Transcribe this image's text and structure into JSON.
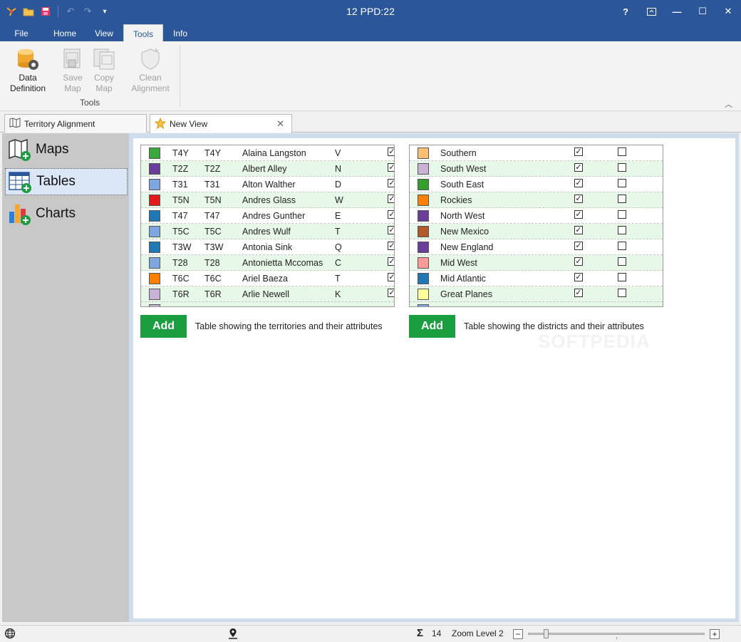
{
  "window": {
    "title": "12 PPD:22",
    "help": "?",
    "minimize": "—",
    "maximize": "☐",
    "close": "✕"
  },
  "ribbon_tabs": [
    "File",
    "Home",
    "View",
    "Tools",
    "Info"
  ],
  "ribbon": {
    "buttons": [
      {
        "label1": "Data",
        "label2": "Definition",
        "icon": "database-gear-icon",
        "enabled": true
      },
      {
        "label1": "Save",
        "label2": "Map",
        "icon": "save-map-icon",
        "enabled": false
      },
      {
        "label1": "Copy",
        "label2": "Map",
        "icon": "copy-map-icon",
        "enabled": false
      },
      {
        "label1": "Clean",
        "label2": "Alignment",
        "icon": "clean-alignment-icon",
        "enabled": false
      }
    ],
    "group_label": "Tools"
  },
  "doc_tabs": [
    {
      "label": "Territory Alignment",
      "icon": "map-icon"
    },
    {
      "label": "New View",
      "icon": "star-icon",
      "close": "✕"
    }
  ],
  "sidebar": {
    "items": [
      {
        "label": "Maps",
        "icon": "map-add-icon"
      },
      {
        "label": "Tables",
        "icon": "table-add-icon"
      },
      {
        "label": "Charts",
        "icon": "chart-add-icon"
      }
    ]
  },
  "territories": {
    "rows": [
      {
        "color": "#3aa83a",
        "code1": "T4Y",
        "code2": "T4Y",
        "name": "Alaina Langston",
        "letter": "V",
        "checked": true
      },
      {
        "color": "#6a3d9a",
        "code1": "T2Z",
        "code2": "T2Z",
        "name": "Albert Alley",
        "letter": "N",
        "checked": true
      },
      {
        "color": "#7ea6e0",
        "code1": "T31",
        "code2": "T31",
        "name": "Alton Walther",
        "letter": "D",
        "checked": true
      },
      {
        "color": "#e31a1c",
        "code1": "T5N",
        "code2": "T5N",
        "name": "Andres Glass",
        "letter": "W",
        "checked": true
      },
      {
        "color": "#1f78b4",
        "code1": "T47",
        "code2": "T47",
        "name": "Andres Gunther",
        "letter": "E",
        "checked": true
      },
      {
        "color": "#7ea6e0",
        "code1": "T5C",
        "code2": "T5C",
        "name": "Andres Wulf",
        "letter": "T",
        "checked": true
      },
      {
        "color": "#1f78b4",
        "code1": "T3W",
        "code2": "T3W",
        "name": "Antonia Sink",
        "letter": "Q",
        "checked": true
      },
      {
        "color": "#7ea6e0",
        "code1": "T28",
        "code2": "T28",
        "name": "Antonietta Mccomas",
        "letter": "C",
        "checked": true
      },
      {
        "color": "#ff7f00",
        "code1": "T6C",
        "code2": "T6C",
        "name": "Ariel Baeza",
        "letter": "T",
        "checked": true
      },
      {
        "color": "#cab2d6",
        "code1": "T6R",
        "code2": "T6R",
        "name": "Arlie Newell",
        "letter": "K",
        "checked": true
      }
    ],
    "add_label": "Add",
    "caption": "Table showing the territories and their attributes"
  },
  "districts": {
    "rows": [
      {
        "color": "#fdbf6f",
        "name": "Southern",
        "check1": true,
        "check2": false
      },
      {
        "color": "#cab2d6",
        "name": "South West",
        "check1": true,
        "check2": false
      },
      {
        "color": "#33a02c",
        "name": "South East",
        "check1": true,
        "check2": false
      },
      {
        "color": "#ff7f00",
        "name": "Rockies",
        "check1": true,
        "check2": false
      },
      {
        "color": "#6a3d9a",
        "name": "North West",
        "check1": true,
        "check2": false
      },
      {
        "color": "#b15928",
        "name": "New Mexico",
        "check1": true,
        "check2": false
      },
      {
        "color": "#6a3d9a",
        "name": "New England",
        "check1": true,
        "check2": false
      },
      {
        "color": "#fb9a99",
        "name": "Mid West",
        "check1": true,
        "check2": false
      },
      {
        "color": "#1f78b4",
        "name": "Mid Atlantic",
        "check1": true,
        "check2": false
      },
      {
        "color": "#ffff99",
        "name": "Great Planes",
        "check1": true,
        "check2": false
      }
    ],
    "add_label": "Add",
    "caption": "Table showing the districts and their attributes"
  },
  "watermark": "SOFTPEDIA",
  "status": {
    "count": "14",
    "zoom_label": "Zoom Level 2",
    "sigma": "Σ",
    "zoom_out": "−",
    "zoom_in": "+"
  }
}
